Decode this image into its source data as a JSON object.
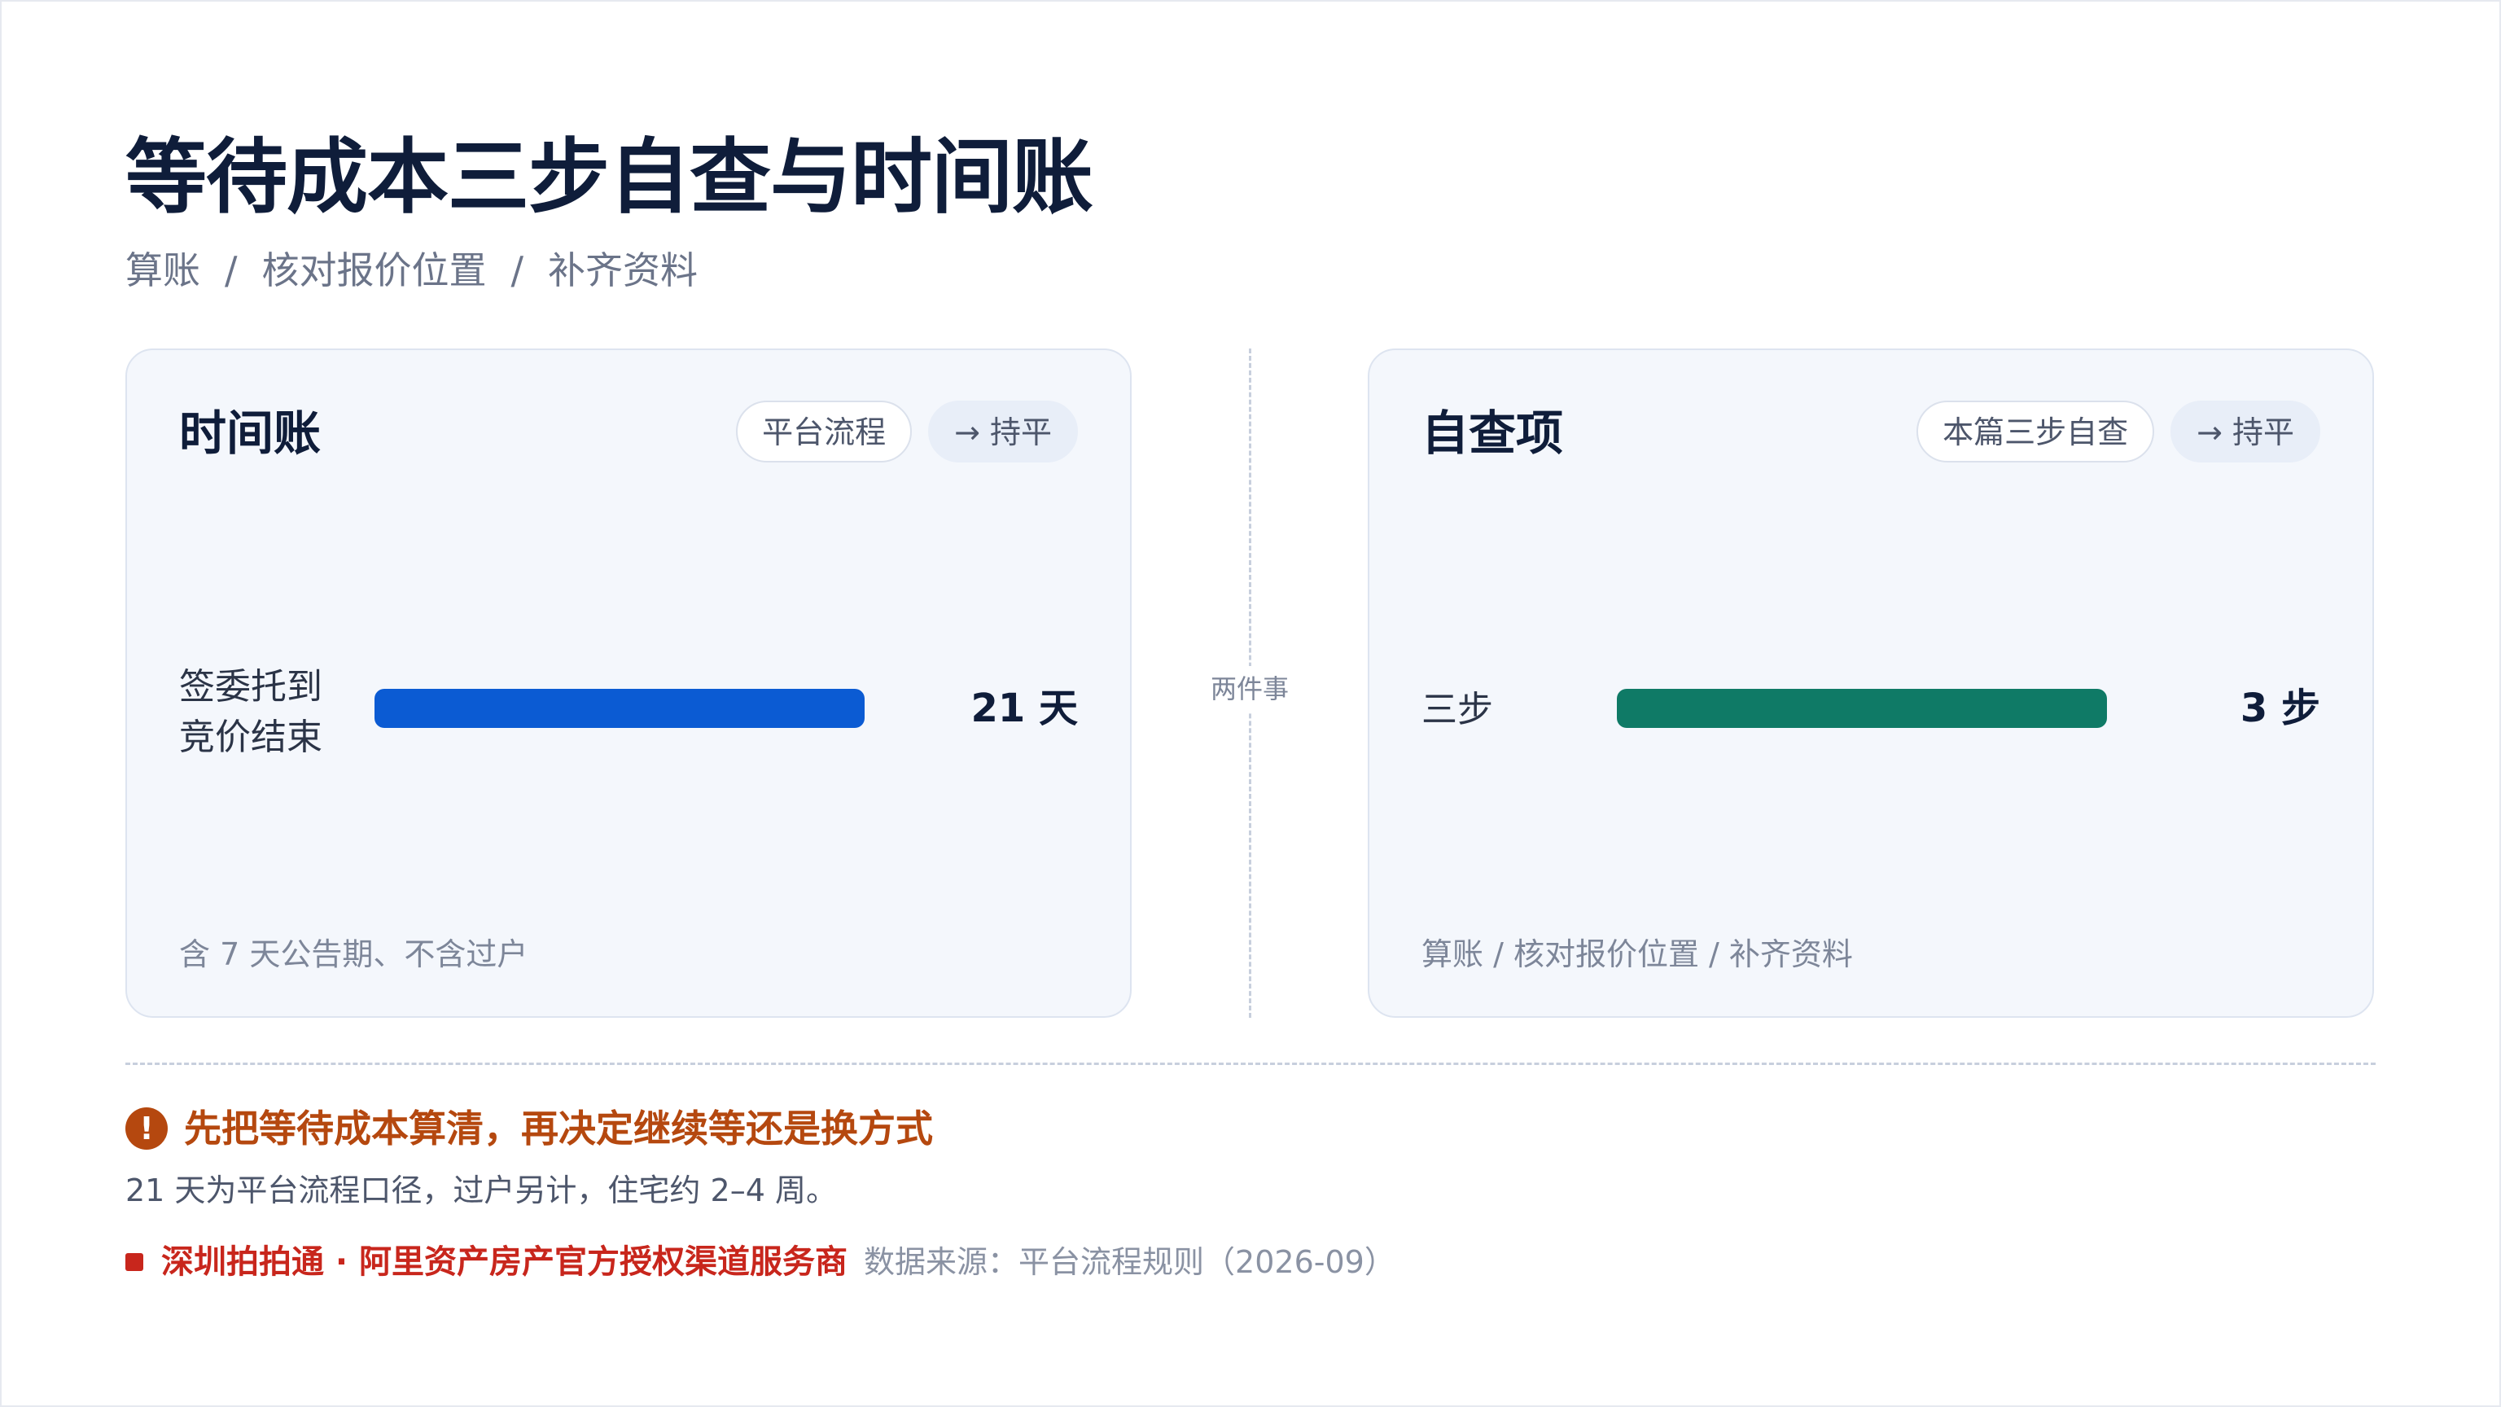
{
  "page": {
    "title": "等待成本三步自查与时间账",
    "breadcrumb": [
      "算账",
      "核对报价位置",
      "补齐资料"
    ],
    "breadcrumb_separator": "/"
  },
  "left_card": {
    "title": "时间账",
    "chip_outline": "平台流程",
    "chip_soft": "→ 持平",
    "row_label_line1": "签委托到",
    "row_label_line2": "竞价结束",
    "bar_color": "#0b5bd3",
    "bar_fraction": 1.0,
    "value": "21 天",
    "note": "含 7 天公告期、不含过户"
  },
  "divider": {
    "label": "两件事"
  },
  "right_card": {
    "title": "自查项",
    "chip_outline": "本篇三步自查",
    "chip_soft": "→ 持平",
    "row_label": "三步",
    "bar_color": "#0f7a66",
    "bar_fraction": 1.0,
    "value": "3 步",
    "note": "算账 / 核对报价位置 / 补齐资料"
  },
  "callout": {
    "icon": "exclamation-icon",
    "headline": "先把等待成本算清，再决定继续等还是换方式",
    "explain": "21 天为平台流程口径，过户另计，住宅约 2–4 周。"
  },
  "source": {
    "brand": "深圳拍拍通 · 阿里资产房产官方授权渠道服务商",
    "meta": "数据来源：平台流程规则（2026-09）"
  },
  "colors": {
    "warning": "#b5480f",
    "brand_red": "#c8261c",
    "title": "#0f1d3a"
  }
}
